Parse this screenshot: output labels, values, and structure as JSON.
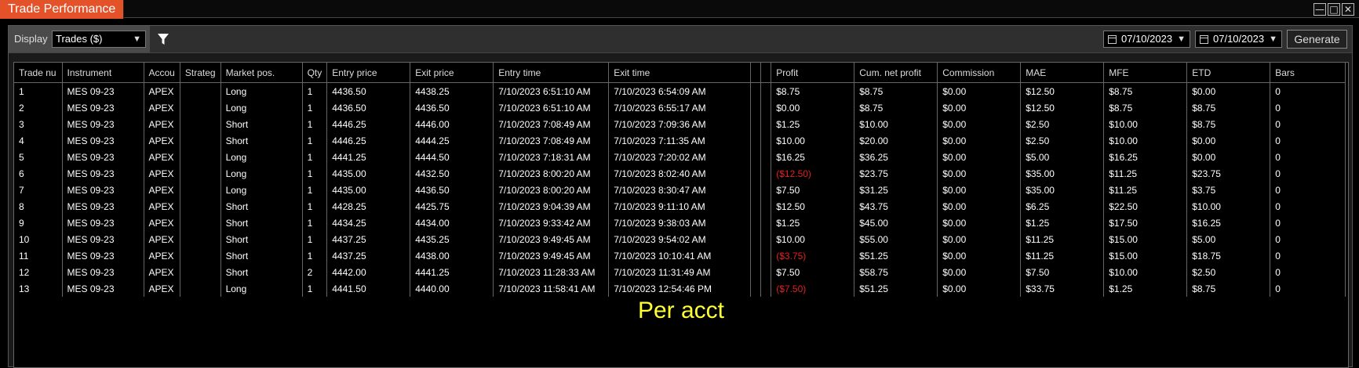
{
  "window": {
    "title": "Trade Performance",
    "minimize": "—",
    "maximize": "□",
    "close": "✕"
  },
  "toolbar": {
    "display_label": "Display",
    "display_value": "Trades ($)",
    "filter_icon": "filter-icon",
    "from_date": "07/10/2023",
    "to_date": "07/10/2023",
    "generate_label": "Generate"
  },
  "table": {
    "columns": [
      "Trade nu",
      "Instrument",
      "Accou",
      "Strateg",
      "Market pos.",
      "Qty",
      "Entry price",
      "Exit price",
      "Entry time",
      "Exit time",
      "",
      "",
      "Profit",
      "Cum. net profit",
      "Commission",
      "MAE",
      "MFE",
      "ETD",
      "Bars"
    ],
    "rows": [
      [
        "1",
        "MES 09-23",
        "APEX",
        "",
        "Long",
        "1",
        "4436.50",
        "4438.25",
        "7/10/2023 6:51:10 AM",
        "7/10/2023 6:54:09 AM",
        "",
        "",
        "$8.75",
        "$8.75",
        "$0.00",
        "$12.50",
        "$8.75",
        "$0.00",
        "0"
      ],
      [
        "2",
        "MES 09-23",
        "APEX",
        "",
        "Long",
        "1",
        "4436.50",
        "4436.50",
        "7/10/2023 6:51:10 AM",
        "7/10/2023 6:55:17 AM",
        "",
        "",
        "$0.00",
        "$8.75",
        "$0.00",
        "$12.50",
        "$8.75",
        "$8.75",
        "0"
      ],
      [
        "3",
        "MES 09-23",
        "APEX",
        "",
        "Short",
        "1",
        "4446.25",
        "4446.00",
        "7/10/2023 7:08:49 AM",
        "7/10/2023 7:09:36 AM",
        "",
        "",
        "$1.25",
        "$10.00",
        "$0.00",
        "$2.50",
        "$10.00",
        "$8.75",
        "0"
      ],
      [
        "4",
        "MES 09-23",
        "APEX",
        "",
        "Short",
        "1",
        "4446.25",
        "4444.25",
        "7/10/2023 7:08:49 AM",
        "7/10/2023 7:11:35 AM",
        "",
        "",
        "$10.00",
        "$20.00",
        "$0.00",
        "$2.50",
        "$10.00",
        "$0.00",
        "0"
      ],
      [
        "5",
        "MES 09-23",
        "APEX",
        "",
        "Long",
        "1",
        "4441.25",
        "4444.50",
        "7/10/2023 7:18:31 AM",
        "7/10/2023 7:20:02 AM",
        "",
        "",
        "$16.25",
        "$36.25",
        "$0.00",
        "$5.00",
        "$16.25",
        "$0.00",
        "0"
      ],
      [
        "6",
        "MES 09-23",
        "APEX",
        "",
        "Long",
        "1",
        "4435.00",
        "4432.50",
        "7/10/2023 8:00:20 AM",
        "7/10/2023 8:02:40 AM",
        "",
        "",
        "($12.50)",
        "$23.75",
        "$0.00",
        "$35.00",
        "$11.25",
        "$23.75",
        "0"
      ],
      [
        "7",
        "MES 09-23",
        "APEX",
        "",
        "Long",
        "1",
        "4435.00",
        "4436.50",
        "7/10/2023 8:00:20 AM",
        "7/10/2023 8:30:47 AM",
        "",
        "",
        "$7.50",
        "$31.25",
        "$0.00",
        "$35.00",
        "$11.25",
        "$3.75",
        "0"
      ],
      [
        "8",
        "MES 09-23",
        "APEX",
        "",
        "Short",
        "1",
        "4428.25",
        "4425.75",
        "7/10/2023 9:04:39 AM",
        "7/10/2023 9:11:10 AM",
        "",
        "",
        "$12.50",
        "$43.75",
        "$0.00",
        "$6.25",
        "$22.50",
        "$10.00",
        "0"
      ],
      [
        "9",
        "MES 09-23",
        "APEX",
        "",
        "Short",
        "1",
        "4434.25",
        "4434.00",
        "7/10/2023 9:33:42 AM",
        "7/10/2023 9:38:03 AM",
        "",
        "",
        "$1.25",
        "$45.00",
        "$0.00",
        "$1.25",
        "$17.50",
        "$16.25",
        "0"
      ],
      [
        "10",
        "MES 09-23",
        "APEX",
        "",
        "Short",
        "1",
        "4437.25",
        "4435.25",
        "7/10/2023 9:49:45 AM",
        "7/10/2023 9:54:02 AM",
        "",
        "",
        "$10.00",
        "$55.00",
        "$0.00",
        "$11.25",
        "$15.00",
        "$5.00",
        "0"
      ],
      [
        "11",
        "MES 09-23",
        "APEX",
        "",
        "Short",
        "1",
        "4437.25",
        "4438.00",
        "7/10/2023 9:49:45 AM",
        "7/10/2023 10:10:41 AM",
        "",
        "",
        "($3.75)",
        "$51.25",
        "$0.00",
        "$11.25",
        "$15.00",
        "$18.75",
        "0"
      ],
      [
        "12",
        "MES 09-23",
        "APEX",
        "",
        "Short",
        "2",
        "4442.00",
        "4441.25",
        "7/10/2023 11:28:33 AM",
        "7/10/2023 11:31:49 AM",
        "",
        "",
        "$7.50",
        "$58.75",
        "$0.00",
        "$7.50",
        "$10.00",
        "$2.50",
        "0"
      ],
      [
        "13",
        "MES 09-23",
        "APEX",
        "",
        "Long",
        "1",
        "4441.50",
        "4440.00",
        "7/10/2023 11:58:41 AM",
        "7/10/2023 12:54:46 PM",
        "",
        "",
        "($7.50)",
        "$51.25",
        "$0.00",
        "$33.75",
        "$1.25",
        "$8.75",
        "0"
      ]
    ]
  },
  "overlay_text": "Per acct",
  "colors": {
    "title_tab": "#e4522a",
    "negative": "#e02020",
    "overlay": "#ffff33"
  }
}
